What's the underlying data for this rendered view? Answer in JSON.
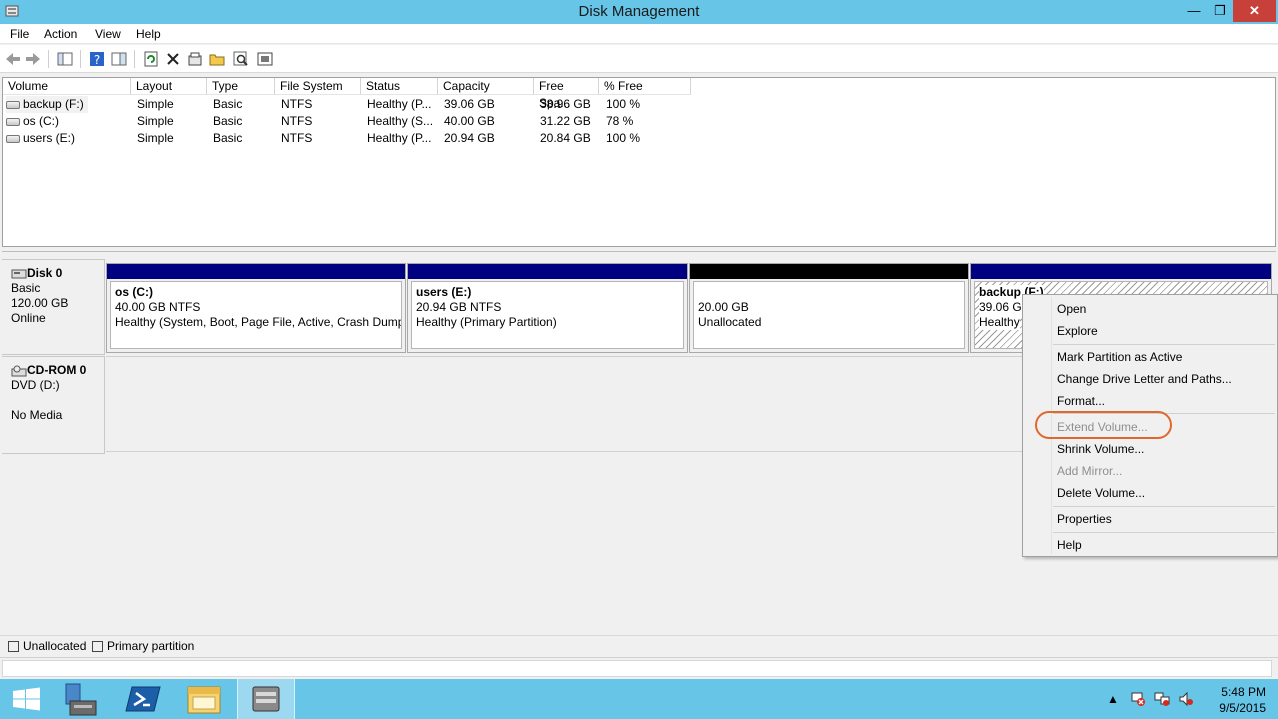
{
  "window": {
    "title": "Disk Management",
    "controls": {
      "minimize": "—",
      "maximize": "❐",
      "close": "✕"
    }
  },
  "menu": [
    "File",
    "Action",
    "View",
    "Help"
  ],
  "toolbar_icons": [
    "back-arrow-icon",
    "forward-arrow-icon",
    "console-tree-icon",
    "help-icon",
    "details-pane-icon",
    "refresh-icon",
    "delete-icon",
    "properties-icon",
    "open-folder-icon",
    "search-icon",
    "drive-settings-icon"
  ],
  "volume_list": {
    "columns": [
      "Volume",
      "Layout",
      "Type",
      "File System",
      "Status",
      "Capacity",
      "Free Spa...",
      "% Free"
    ],
    "rows": [
      [
        "backup (F:)",
        "Simple",
        "Basic",
        "NTFS",
        "Healthy (P...",
        "39.06 GB",
        "38.96 GB",
        "100 %"
      ],
      [
        "os (C:)",
        "Simple",
        "Basic",
        "NTFS",
        "Healthy (S...",
        "40.00 GB",
        "31.22 GB",
        "78 %"
      ],
      [
        "users (E:)",
        "Simple",
        "Basic",
        "NTFS",
        "Healthy (P...",
        "20.94 GB",
        "20.84 GB",
        "100 %"
      ]
    ]
  },
  "disk0": {
    "name": "Disk 0",
    "type": "Basic",
    "size": "120.00 GB",
    "state": "Online",
    "partitions": [
      {
        "name": "os  (C:)",
        "size": "40.00 GB NTFS",
        "status": "Healthy (System, Boot, Page File, Active, Crash Dump,",
        "kind": "primary"
      },
      {
        "name": "users  (E:)",
        "size": "20.94 GB NTFS",
        "status": "Healthy (Primary Partition)",
        "kind": "primary"
      },
      {
        "name": "",
        "size": "20.00 GB",
        "status": "Unallocated",
        "kind": "unallocated"
      },
      {
        "name": "backup  (F:)",
        "size": "39.06 GB",
        "status": "Healthy",
        "kind": "primary-selected"
      }
    ]
  },
  "cdrom0": {
    "name": "CD-ROM 0",
    "drive": "DVD (D:)",
    "media": "No Media"
  },
  "legend": [
    {
      "label": "Unallocated",
      "color": "#000000"
    },
    {
      "label": "Primary partition",
      "color": "#000080"
    }
  ],
  "context_menu": {
    "items": [
      {
        "label": "Open",
        "enabled": true
      },
      {
        "label": "Explore",
        "enabled": true
      },
      {
        "label": "Mark Partition as Active",
        "enabled": true
      },
      {
        "label": "Change Drive Letter and Paths...",
        "enabled": true
      },
      {
        "label": "Format...",
        "enabled": true
      },
      {
        "label": "Extend Volume...",
        "enabled": false,
        "highlighted": true
      },
      {
        "label": "Shrink Volume...",
        "enabled": true
      },
      {
        "label": "Add Mirror...",
        "enabled": false
      },
      {
        "label": "Delete Volume...",
        "enabled": true
      },
      {
        "label": "Properties",
        "enabled": true
      },
      {
        "label": "Help",
        "enabled": true
      }
    ]
  },
  "taskbar": {
    "apps": [
      "start-button",
      "server-manager-icon",
      "powershell-icon",
      "file-explorer-icon",
      "disk-management-icon"
    ],
    "time": "5:48 PM",
    "date": "9/5/2015"
  },
  "colors": {
    "titlebar": "#67c5e8",
    "primary_partition": "#000080",
    "unallocated": "#000000",
    "highlight_ring": "#e0682c"
  }
}
